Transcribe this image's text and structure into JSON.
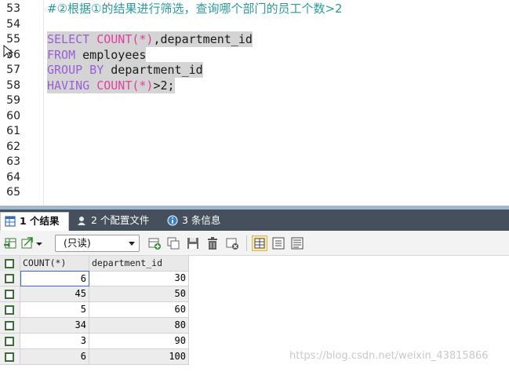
{
  "editor": {
    "lines": [
      {
        "num": "53",
        "comment": "#②根据①的结果进行筛选，查询哪个部门的员工个数>2"
      },
      {
        "num": "54"
      },
      {
        "num": "55",
        "kw1": "SELECT",
        "fn": "COUNT",
        "args": "(*)",
        "rest": ",department_id"
      },
      {
        "num": "56",
        "kw1": "FROM",
        "rest": " employees"
      },
      {
        "num": "57",
        "kw1": "GROUP BY",
        "rest": " department_id"
      },
      {
        "num": "58",
        "kw1": "HAVING",
        "fn": "COUNT",
        "args": "(*)",
        "rest": ">2;"
      },
      {
        "num": "59"
      },
      {
        "num": "60"
      },
      {
        "num": "61"
      },
      {
        "num": "62"
      },
      {
        "num": "63"
      },
      {
        "num": "64"
      },
      {
        "num": "65"
      }
    ]
  },
  "tabs": [
    {
      "label": "1 个结果",
      "icon": "grid-icon"
    },
    {
      "label": "2 个配置文件",
      "icon": "profile-icon"
    },
    {
      "label": "3 条信息",
      "icon": "info-icon"
    }
  ],
  "toolbar": {
    "mode_value": "(只读)"
  },
  "grid": {
    "columns": [
      "COUNT(*)",
      "department_id"
    ],
    "rows": [
      [
        "6",
        "30"
      ],
      [
        "45",
        "50"
      ],
      [
        "5",
        "60"
      ],
      [
        "34",
        "80"
      ],
      [
        "3",
        "90"
      ],
      [
        "6",
        "100"
      ]
    ]
  },
  "watermark": "https://blog.csdn.net/weixin_43815866",
  "colors": {
    "keyword": "#9a5fd6",
    "function": "#e040a0",
    "comment": "#2b9a9a",
    "selection": "#d4d4d4",
    "tabbar": "#45505c"
  }
}
